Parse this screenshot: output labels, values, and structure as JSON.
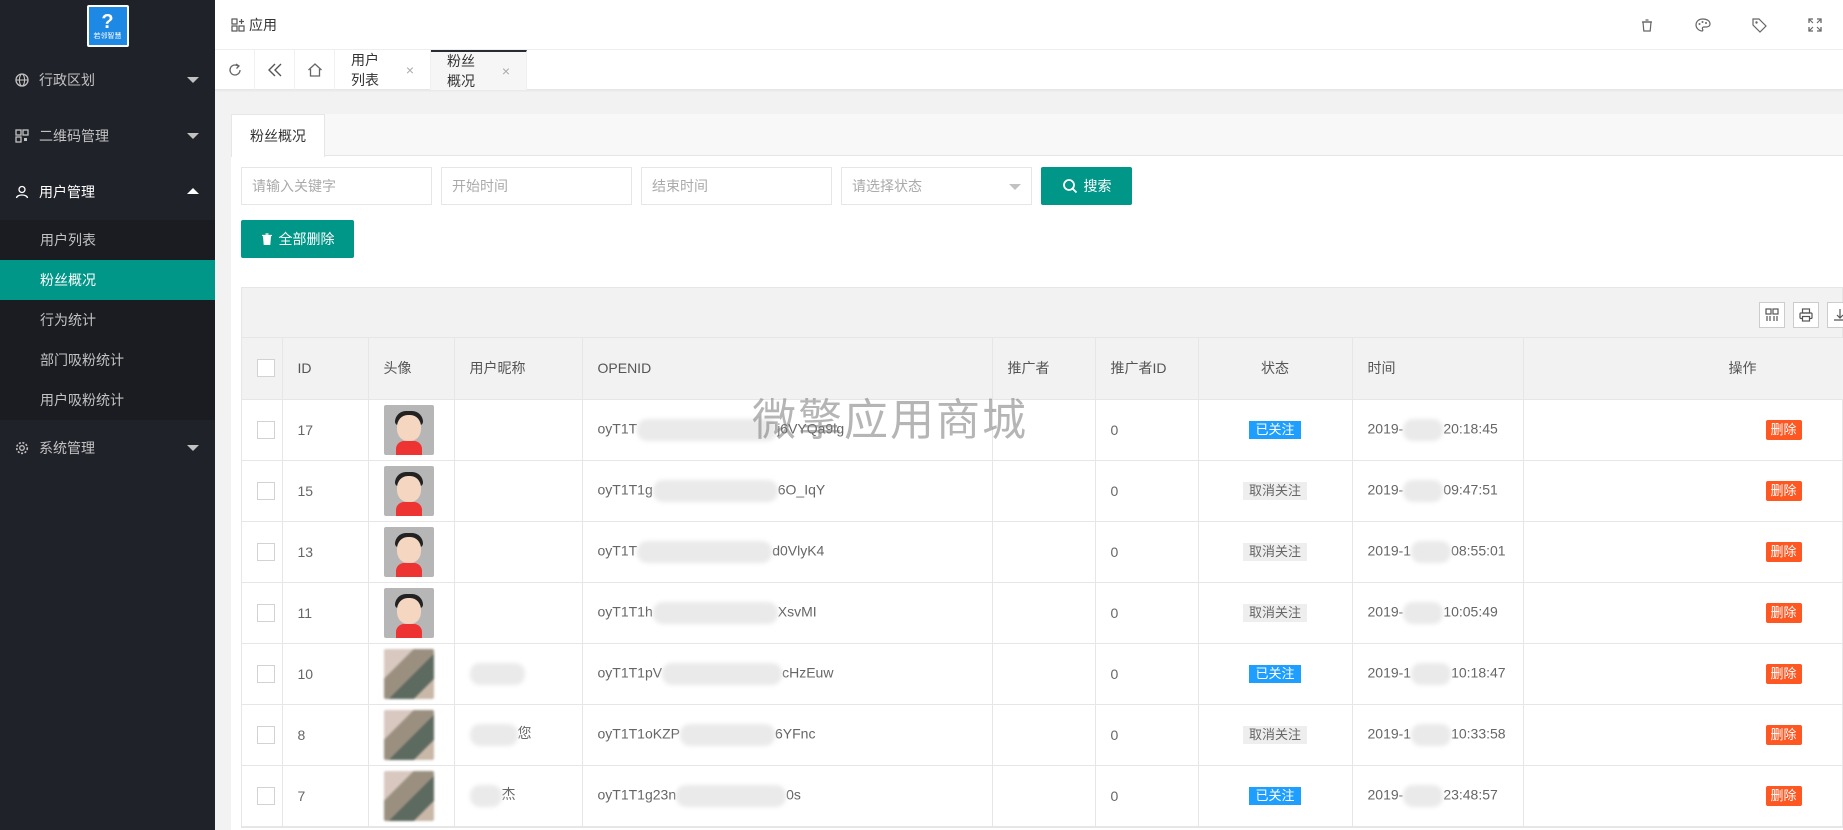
{
  "sidebar": {
    "logo": {
      "mark": "?",
      "text": "若邻智慧"
    },
    "menu": [
      {
        "label": "行政区划",
        "icon": "globe-icon"
      },
      {
        "label": "二维码管理",
        "icon": "qrcode-icon"
      },
      {
        "label": "用户管理",
        "icon": "user-icon",
        "children": [
          "用户列表",
          "粉丝概况",
          "行为统计",
          "部门吸粉统计",
          "用户吸粉统计"
        ]
      },
      {
        "label": "系统管理",
        "icon": "gear-icon"
      }
    ],
    "active_sub": "粉丝概况",
    "accent": "#009688"
  },
  "header": {
    "app_label": "应用",
    "icons": [
      "trash-icon",
      "palette-icon",
      "tag-icon",
      "fullscreen-icon"
    ]
  },
  "tabs": {
    "items": [
      {
        "label": "用户列表"
      },
      {
        "label": "粉丝概况",
        "active": true
      }
    ],
    "close": "×"
  },
  "content": {
    "tab": "粉丝概况",
    "filters": {
      "keyword_placeholder": "请输入关键字",
      "start_placeholder": "开始时间",
      "end_placeholder": "结束时间",
      "status_placeholder": "请选择状态",
      "search_label": "搜索"
    },
    "delete_all_label": "全部删除"
  },
  "table": {
    "columns": [
      "ID",
      "头像",
      "用户昵称",
      "OPENID",
      "推广者",
      "推广者ID",
      "状态",
      "时间",
      "操作"
    ],
    "rows": [
      {
        "id": "17",
        "avatar": "cartoon",
        "nickname": "",
        "openid_pre": "oyT1T",
        "openid_suf": "j6VYQa9lg",
        "promoter": "",
        "promoter_id": "0",
        "status": "已关注",
        "followed": true,
        "time_pre": "2019-",
        "time_suf": "20:18:45",
        "op": "删除"
      },
      {
        "id": "15",
        "avatar": "cartoon",
        "nickname": "",
        "openid_pre": "oyT1T1g",
        "openid_suf": "6O_IqY",
        "promoter": "",
        "promoter_id": "0",
        "status": "取消关注",
        "followed": false,
        "time_pre": "2019-",
        "time_suf": "09:47:51",
        "op": "删除"
      },
      {
        "id": "13",
        "avatar": "cartoon",
        "nickname": "",
        "openid_pre": "oyT1T",
        "openid_suf": "d0VlyK4",
        "promoter": "",
        "promoter_id": "0",
        "status": "取消关注",
        "followed": false,
        "time_pre": "2019-1",
        "time_suf": "08:55:01",
        "op": "删除"
      },
      {
        "id": "11",
        "avatar": "cartoon",
        "nickname": "",
        "openid_pre": "oyT1T1h",
        "openid_suf": "XsvMI",
        "promoter": "",
        "promoter_id": "0",
        "status": "取消关注",
        "followed": false,
        "time_pre": "2019-",
        "time_suf": "10:05:49",
        "op": "删除"
      },
      {
        "id": "10",
        "avatar": "photo",
        "nickname": "",
        "openid_pre": "oyT1T1pV",
        "openid_suf": "cHzEuw",
        "promoter": "",
        "promoter_id": "0",
        "status": "已关注",
        "followed": true,
        "time_pre": "2019-1",
        "time_suf": "10:18:47",
        "op": "删除"
      },
      {
        "id": "8",
        "avatar": "photo",
        "nickname": "您",
        "openid_pre": "oyT1T1oKZP",
        "openid_suf": "6YFnc",
        "promoter": "",
        "promoter_id": "0",
        "status": "取消关注",
        "followed": false,
        "time_pre": "2019-1",
        "time_suf": "10:33:58",
        "op": "删除"
      },
      {
        "id": "7",
        "avatar": "photo",
        "nickname": "杰",
        "openid_pre": "oyT1T1g23n",
        "openid_suf": "0s",
        "promoter": "",
        "promoter_id": "0",
        "status": "已关注",
        "followed": true,
        "time_pre": "2019-",
        "time_suf": "23:48:57",
        "op": "删除"
      }
    ],
    "colors": {
      "followed": "#1e9fff",
      "unfollowed": "#eeeeee",
      "delete": "#ff5722"
    }
  },
  "watermark": "微擎应用商城"
}
